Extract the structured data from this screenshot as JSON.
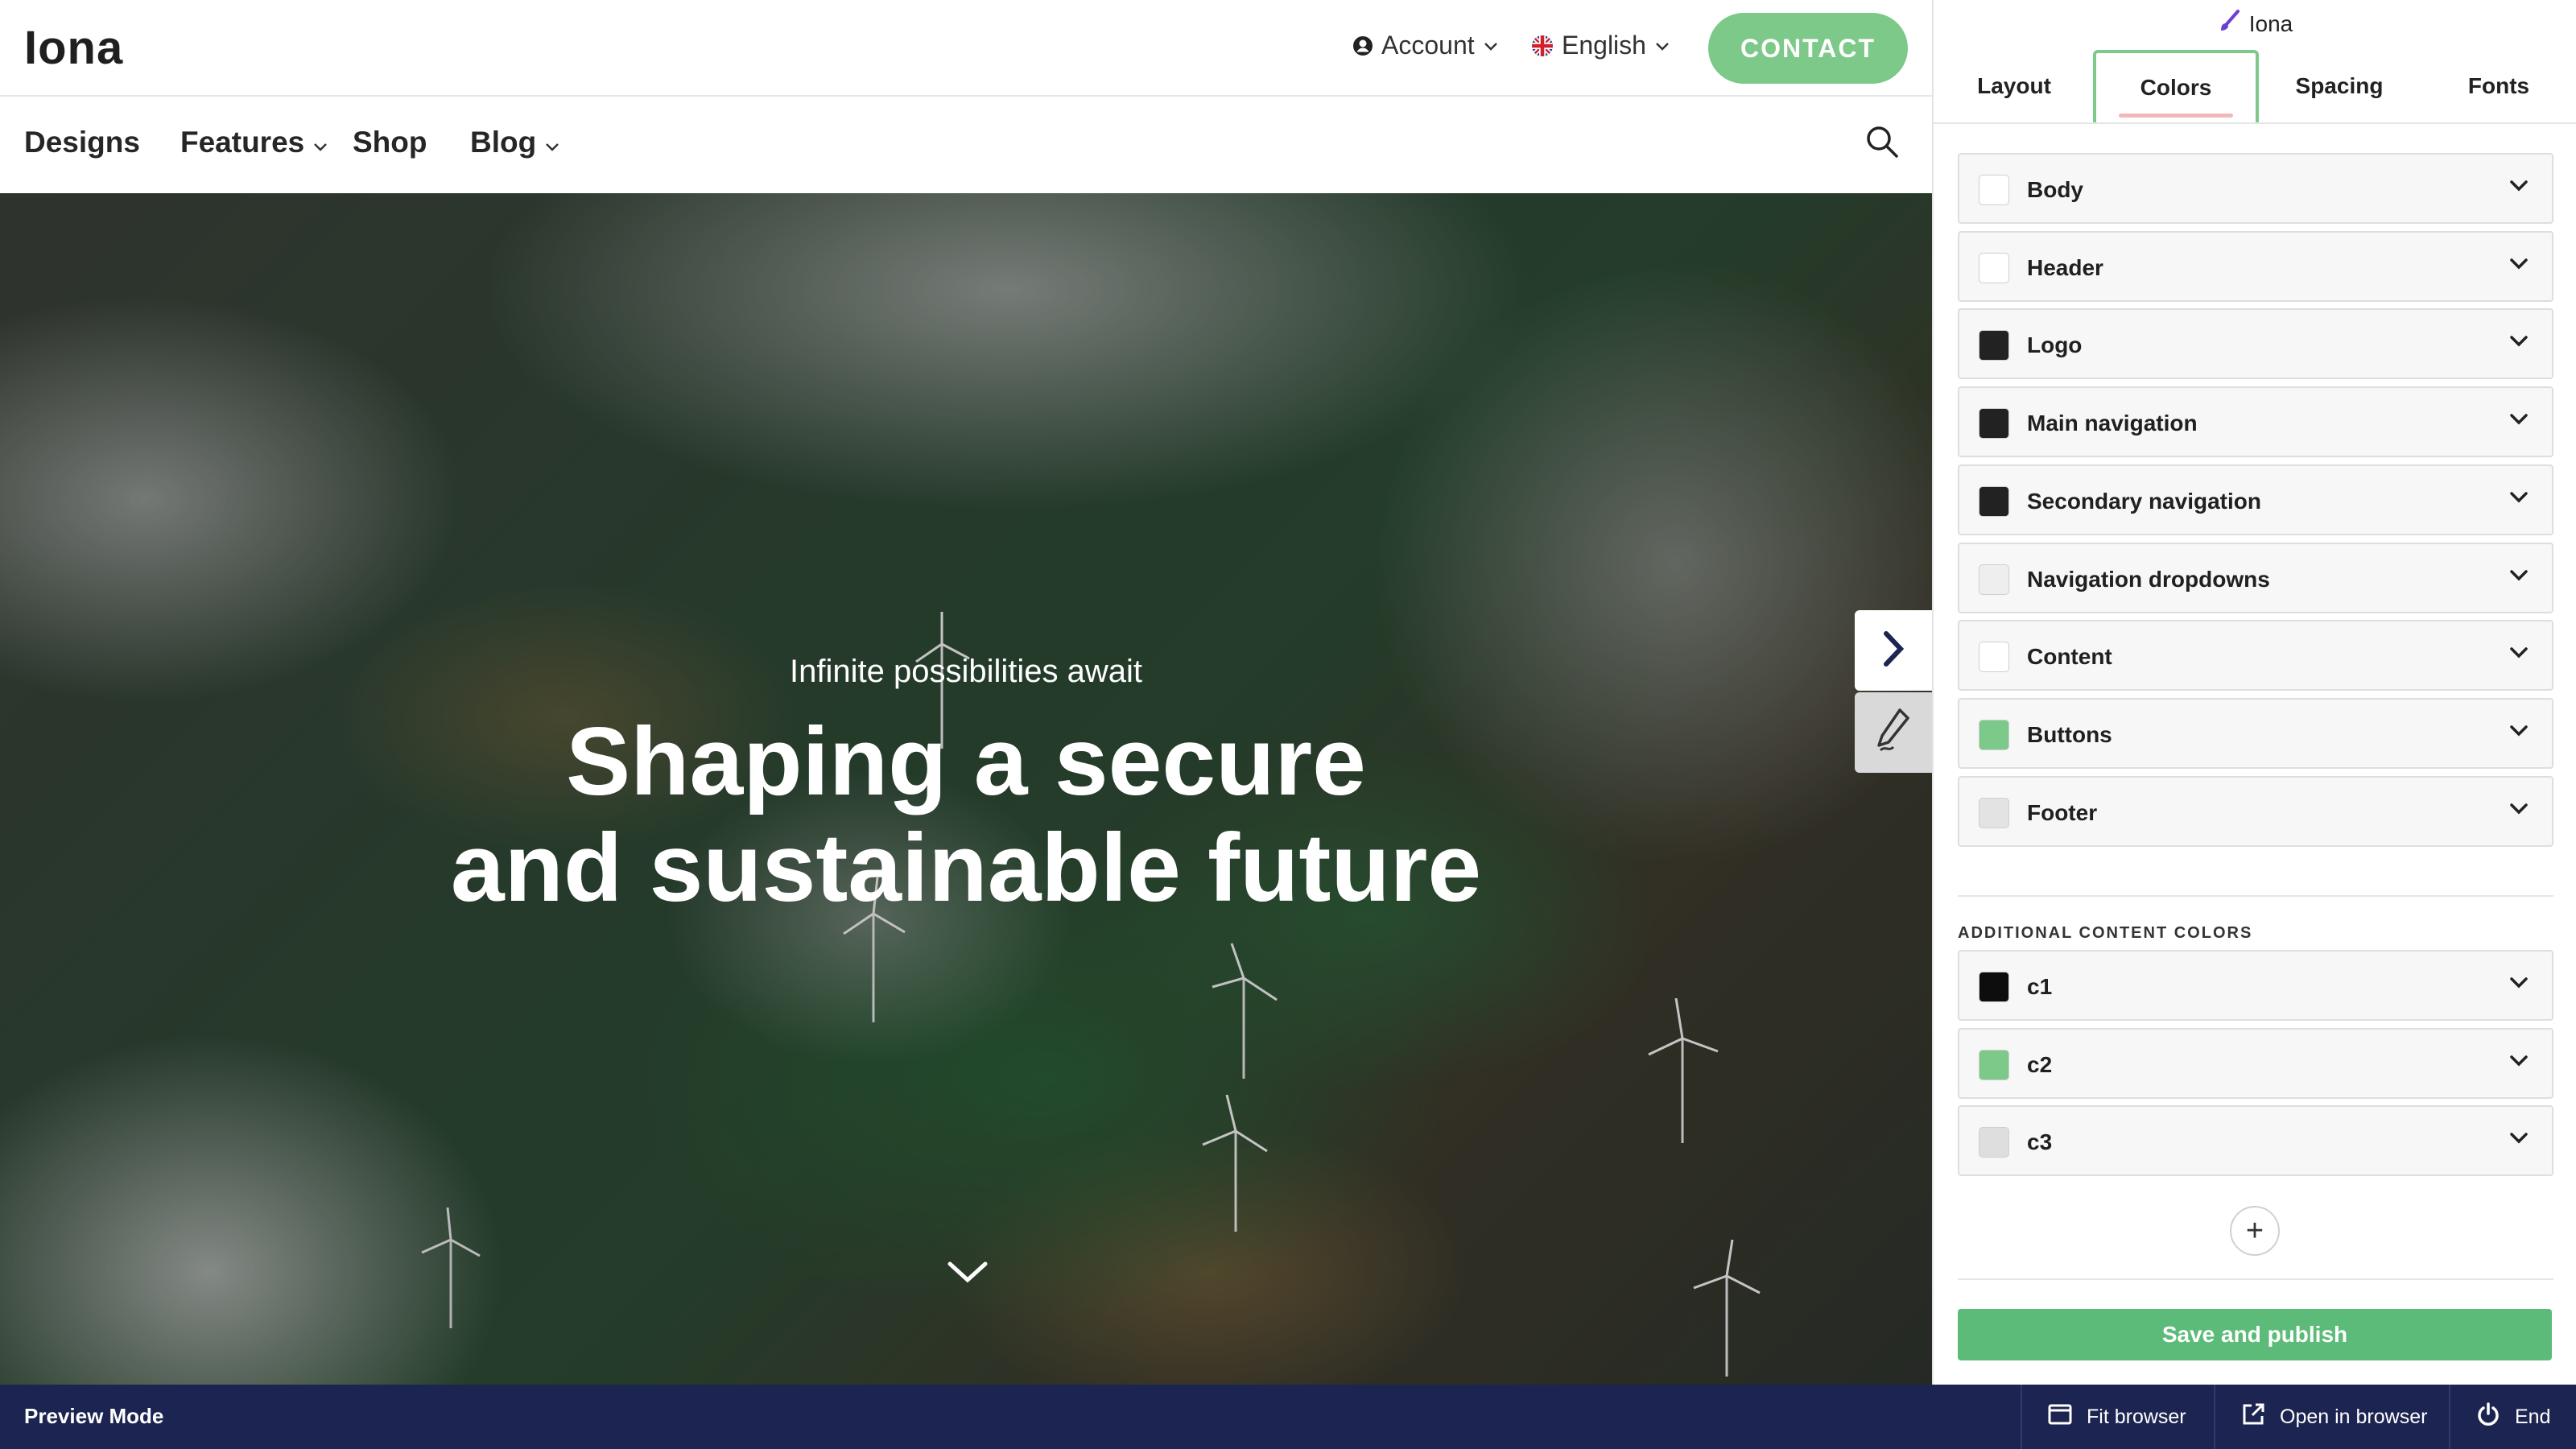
{
  "site": {
    "logo": "Iona",
    "utility": {
      "account_label": "Account",
      "language_label": "English",
      "contact_label": "CONTACT"
    },
    "nav": [
      {
        "label": "Designs",
        "has_dropdown": false
      },
      {
        "label": "Features",
        "has_dropdown": true
      },
      {
        "label": "Shop",
        "has_dropdown": false
      },
      {
        "label": "Blog",
        "has_dropdown": true
      }
    ],
    "hero": {
      "kicker": "Infinite possibilities await",
      "title_line1": "Shaping a secure",
      "title_line2": "and sustainable future"
    }
  },
  "panel": {
    "title": "Iona",
    "tabs": [
      {
        "label": "Layout",
        "active": false
      },
      {
        "label": "Colors",
        "active": true
      },
      {
        "label": "Spacing",
        "active": false
      },
      {
        "label": "Fonts",
        "active": false
      }
    ],
    "color_groups": [
      {
        "label": "Body",
        "color": "#ffffff"
      },
      {
        "label": "Header",
        "color": "#ffffff"
      },
      {
        "label": "Logo",
        "color": "#222222"
      },
      {
        "label": "Main navigation",
        "color": "#222222"
      },
      {
        "label": "Secondary navigation",
        "color": "#222222"
      },
      {
        "label": "Navigation dropdowns",
        "color": "#eeeeee"
      },
      {
        "label": "Content",
        "color": "#ffffff"
      },
      {
        "label": "Buttons",
        "color": "#7dc98a"
      },
      {
        "label": "Footer",
        "color": "#e3e3e3"
      }
    ],
    "additional_heading": "ADDITIONAL CONTENT COLORS",
    "additional_colors": [
      {
        "label": "c1",
        "color": "#0d0d0d"
      },
      {
        "label": "c2",
        "color": "#7dc98a"
      },
      {
        "label": "c3",
        "color": "#dedede"
      }
    ],
    "add_label": "+",
    "save_label": "Save and publish"
  },
  "bottombar": {
    "mode_label": "Preview Mode",
    "fit_label": "Fit browser",
    "open_label": "Open in browser",
    "end_label": "End"
  },
  "colors": {
    "accent_green": "#7dc98a",
    "save_green": "#5dbb79",
    "bottombar_navy": "#1c2551"
  }
}
